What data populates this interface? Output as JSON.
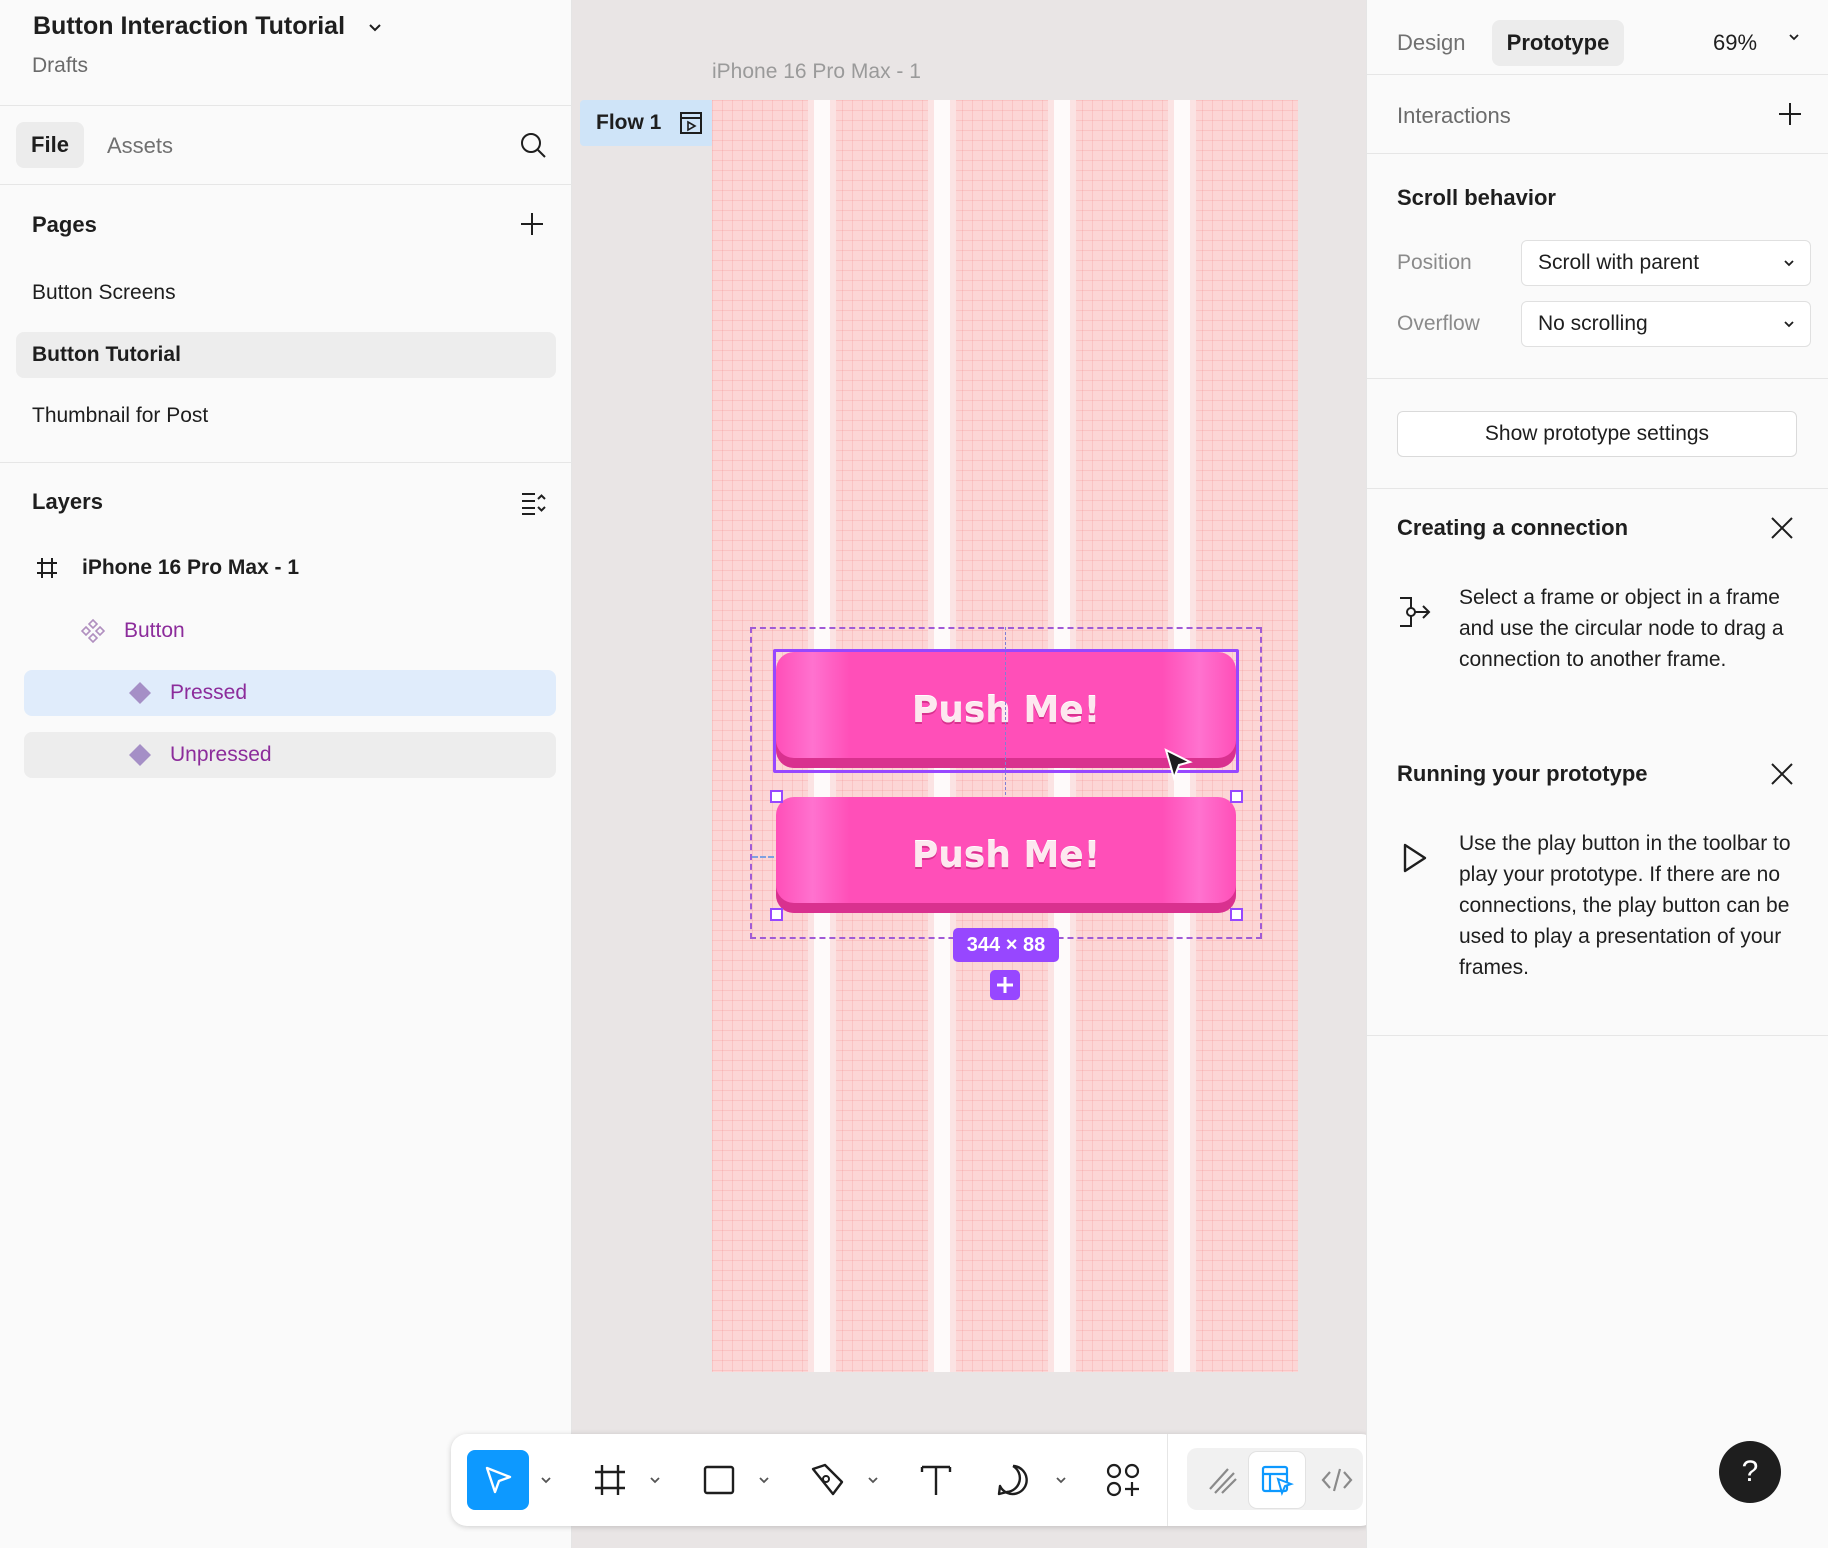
{
  "project": {
    "title": "Button Interaction Tutorial",
    "location": "Drafts"
  },
  "left_tabs": {
    "file": "File",
    "assets": "Assets"
  },
  "pages": {
    "title": "Pages",
    "items": [
      {
        "label": "Button Screens",
        "active": false
      },
      {
        "label": "Button Tutorial",
        "active": true
      },
      {
        "label": "Thumbnail for Post",
        "active": false
      }
    ]
  },
  "layers": {
    "title": "Layers",
    "frame": "iPhone 16 Pro Max - 1",
    "component": "Button",
    "variants": [
      {
        "label": "Pressed",
        "selected": true
      },
      {
        "label": "Unpressed",
        "selected": false
      }
    ]
  },
  "canvas": {
    "frame_label": "iPhone 16 Pro Max - 1",
    "flow_label": "Flow 1",
    "button_text_pressed": "Push Me!",
    "button_text_unpressed": "Push Me!",
    "selection_size": "344 × 88"
  },
  "right": {
    "tabs": {
      "design": "Design",
      "prototype": "Prototype"
    },
    "zoom": "69%",
    "interactions": "Interactions",
    "scroll_behavior": "Scroll behavior",
    "position_label": "Position",
    "position_value": "Scroll with parent",
    "overflow_label": "Overflow",
    "overflow_value": "No scrolling",
    "show_settings": "Show prototype settings",
    "creating_title": "Creating a connection",
    "creating_body": "Select a frame or object in a frame and use the circular node to drag a connection to another frame.",
    "running_title": "Running your prototype",
    "running_body": "Use the play button in the toolbar to play your prototype. If there are no connections, the play button can be used to play a presentation of your frames."
  },
  "help": "?",
  "colors": {
    "accent": "#0d99ff",
    "selection": "#9747ff",
    "component": "#8c2c9b",
    "button": "#ff4fb8",
    "frame_bg": "#fcd6d6"
  }
}
